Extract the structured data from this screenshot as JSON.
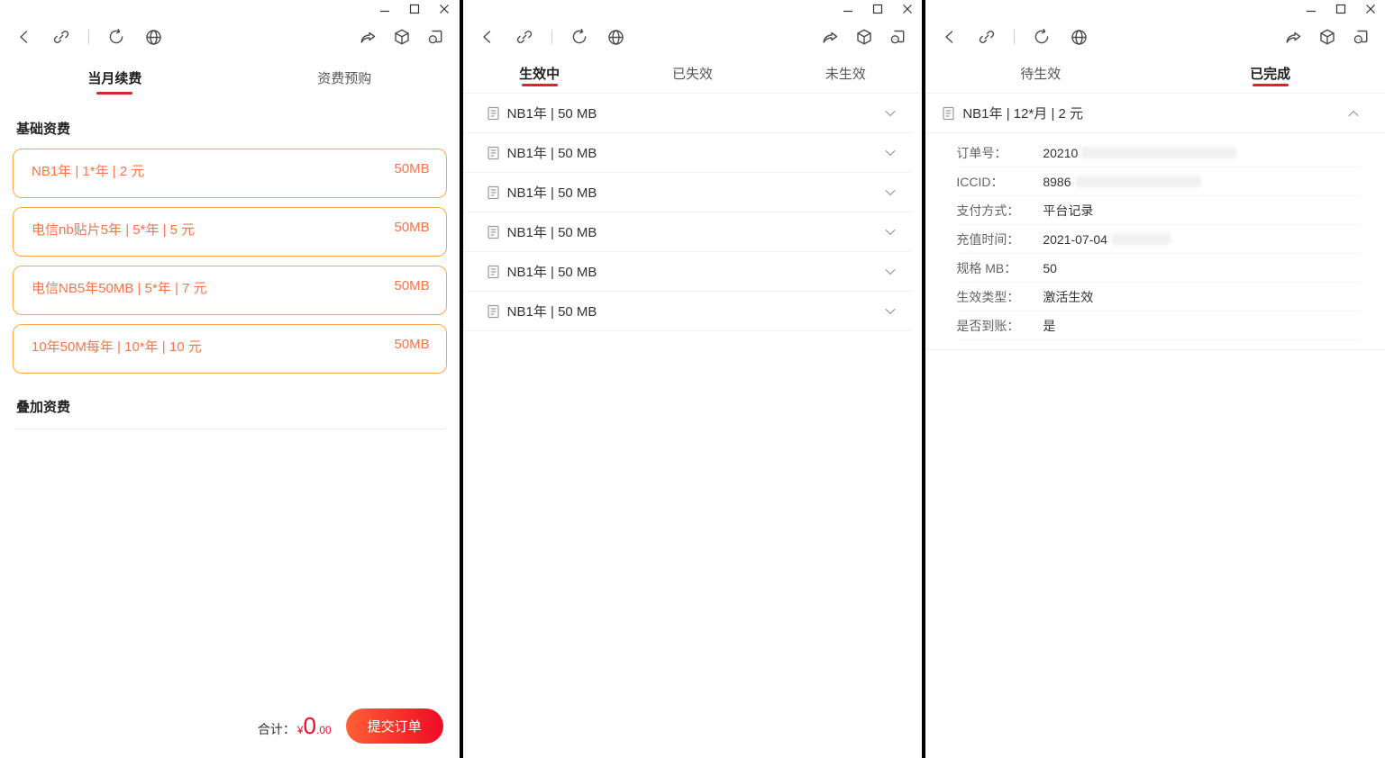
{
  "colors": {
    "accent_red": "#e2202e",
    "card_border": "#ffa940",
    "card_text": "#ff7245",
    "button_gradient_start": "#ff6034",
    "button_gradient_end": "#ee0a24"
  },
  "toolbar_icons": [
    "back",
    "link",
    "refresh",
    "globe",
    "share",
    "package",
    "plugin"
  ],
  "windows": [
    {
      "tabs": [
        {
          "label": "当月续费",
          "active": true
        },
        {
          "label": "资费预购",
          "active": false
        }
      ],
      "section_basic": "基础资费",
      "section_addon": "叠加资费",
      "cards": [
        {
          "title": "NB1年 | 1*年 | 2 元",
          "spec": "50MB"
        },
        {
          "title": "电信nb贴片5年 | 5*年 | 5 元",
          "spec": "50MB"
        },
        {
          "title": "电信NB5年50MB | 5*年 | 7 元",
          "spec": "50MB"
        },
        {
          "title": "10年50M每年 | 10*年 | 10 元",
          "spec": "50MB"
        }
      ],
      "footer": {
        "total_label": "合计：",
        "currency": "¥",
        "amount_int": "0",
        "amount_dec": ".00",
        "submit_label": "提交订单"
      }
    },
    {
      "tabs": [
        {
          "label": "生效中",
          "active": true
        },
        {
          "label": "已失效",
          "active": false
        },
        {
          "label": "未生效",
          "active": false
        }
      ],
      "items": [
        {
          "title": "NB1年 | 50 MB"
        },
        {
          "title": "NB1年 | 50 MB"
        },
        {
          "title": "NB1年 | 50 MB"
        },
        {
          "title": "NB1年 | 50 MB"
        },
        {
          "title": "NB1年 | 50 MB"
        },
        {
          "title": "NB1年 | 50 MB"
        }
      ]
    },
    {
      "tabs": [
        {
          "label": "待生效",
          "active": false
        },
        {
          "label": "已完成",
          "active": true
        }
      ],
      "order": {
        "title": "NB1年 | 12*月 | 2 元"
      },
      "details": [
        {
          "label": "订单号：",
          "value": "20210",
          "redacted": true
        },
        {
          "label": "ICCID：",
          "value": "8986",
          "redacted": true
        },
        {
          "label": "支付方式：",
          "value": "平台记录"
        },
        {
          "label": "充值时间：",
          "value": "2021-07-04",
          "redacted": true
        },
        {
          "label": "规格 MB：",
          "value": "50"
        },
        {
          "label": "生效类型：",
          "value": "激活生效"
        },
        {
          "label": "是否到账：",
          "value": "是"
        }
      ]
    }
  ]
}
